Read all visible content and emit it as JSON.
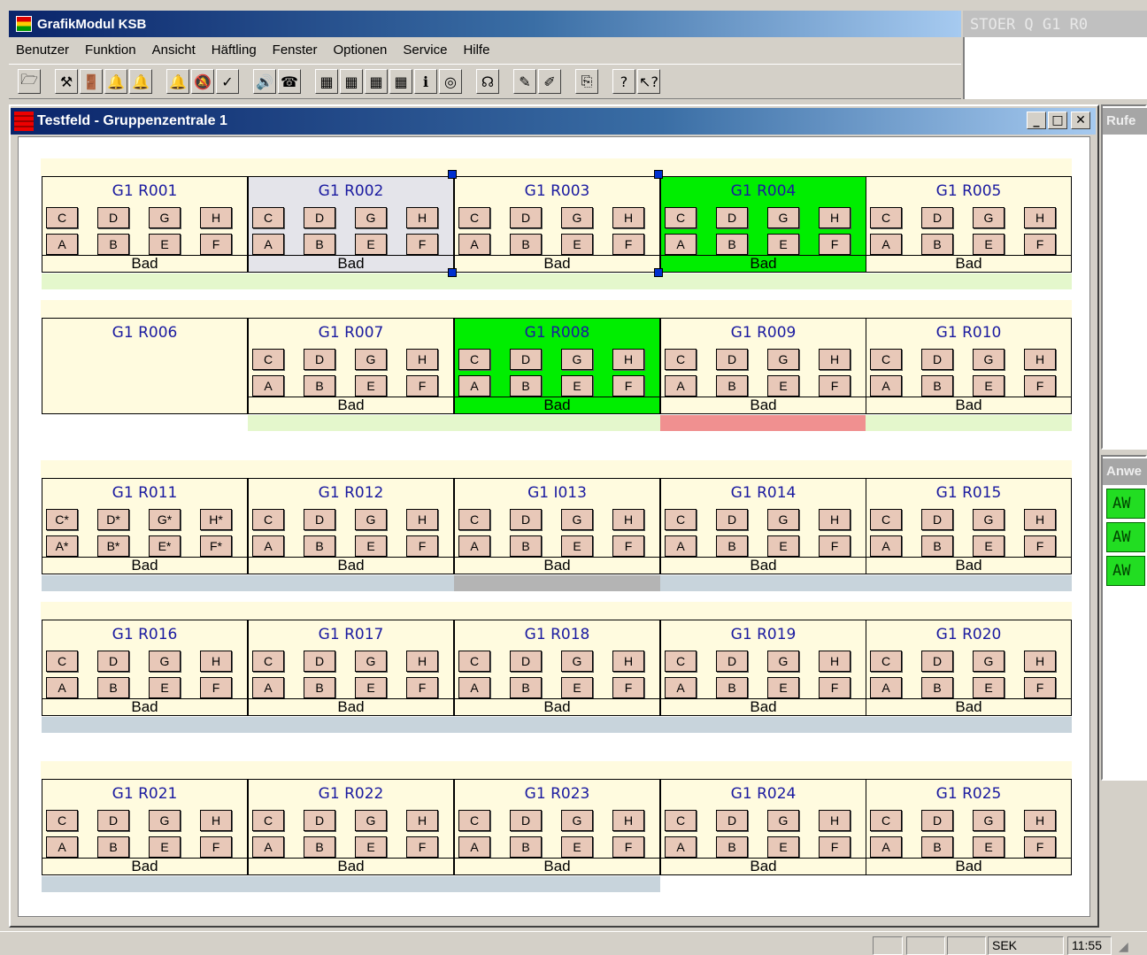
{
  "app": {
    "title": "GrafikModul KSB",
    "stoer_text": "STOER Q G1 R0",
    "menu": [
      "Benutzer",
      "Funktion",
      "Ansicht",
      "Häftling",
      "Fenster",
      "Optionen",
      "Service",
      "Hilfe"
    ],
    "toolbar_icons": [
      "open-icon",
      "hammer-icon",
      "door-icon",
      "bell-icon",
      "bell-green-icon",
      "bell-x-icon",
      "bell-gray-icon",
      "check-icon",
      "speaker-icon",
      "phone-icon",
      "calc-red-icon",
      "calc-red-icon",
      "calc-green-icon",
      "calc-gray-icon",
      "info-icon",
      "globe-icon",
      "ear-icon",
      "pen-icon",
      "pen2-icon",
      "copy-icon",
      "help-icon",
      "whatis-icon"
    ],
    "toolbar_glyphs": [
      "🗁",
      "⚒",
      "🚪",
      "🔔",
      "🔔",
      "🔔",
      "🔕",
      "✓",
      "🔊",
      "☎",
      "▦",
      "▦",
      "▦",
      "▦",
      "ℹ",
      "◎",
      "☊",
      "✎",
      "✐",
      "⎘",
      "?",
      "↖?"
    ]
  },
  "window": {
    "title": "Testfeld - Gruppenzentrale 1",
    "min": "_",
    "max": "□",
    "close": "✕"
  },
  "side": {
    "panel1_title": "Rufe",
    "panel2_title": "Anwe",
    "aw_items": [
      "AW",
      "AW",
      "AW"
    ]
  },
  "status": {
    "panes": [
      "",
      "",
      "",
      "SEK",
      "11:55"
    ]
  },
  "bed_labels": {
    "top": [
      "C",
      "D",
      "G",
      "H"
    ],
    "bottom": [
      "A",
      "B",
      "E",
      "F"
    ],
    "top_star": [
      "C*",
      "D*",
      "G*",
      "H*"
    ],
    "bottom_star": [
      "A*",
      "B*",
      "E*",
      "F*"
    ]
  },
  "bad_label": "Bad",
  "rooms": [
    {
      "name": "G1 R001",
      "state": "normal",
      "beds": true,
      "strip": "#e4f7cc"
    },
    {
      "name": "G1 R002",
      "state": "selected",
      "beds": true,
      "strip": "#e4f7cc"
    },
    {
      "name": "G1 R003",
      "state": "normal",
      "beds": true,
      "strip": "#e4f7cc"
    },
    {
      "name": "G1 R004",
      "state": "green",
      "beds": true,
      "strip": "#e4f7cc"
    },
    {
      "name": "G1 R005",
      "state": "normal",
      "beds": true,
      "strip": "#e4f7cc"
    },
    {
      "name": "G1 R006",
      "state": "normal",
      "beds": false,
      "strip": ""
    },
    {
      "name": "G1 R007",
      "state": "normal",
      "beds": true,
      "strip": "#e4f7cc"
    },
    {
      "name": "G1 R008",
      "state": "green",
      "beds": true,
      "strip": "#e4f7cc"
    },
    {
      "name": "G1 R009",
      "state": "normal",
      "beds": true,
      "strip": "#f09090"
    },
    {
      "name": "G1 R010",
      "state": "normal",
      "beds": true,
      "strip": "#e4f7cc"
    },
    {
      "name": "G1 R011",
      "state": "normal",
      "beds": true,
      "star": true,
      "strip": "#c8d4dc"
    },
    {
      "name": "G1 R012",
      "state": "normal",
      "beds": true,
      "strip": "#c8d4dc"
    },
    {
      "name": "G1 I013",
      "state": "normal",
      "beds": true,
      "strip": "#b4b4b4"
    },
    {
      "name": "G1 R014",
      "state": "normal",
      "beds": true,
      "strip": "#c8d4dc"
    },
    {
      "name": "G1 R015",
      "state": "normal",
      "beds": true,
      "strip": "#c8d4dc"
    },
    {
      "name": "G1 R016",
      "state": "normal",
      "beds": true,
      "strip": "#c8d4dc"
    },
    {
      "name": "G1 R017",
      "state": "normal",
      "beds": true,
      "strip": "#c8d4dc"
    },
    {
      "name": "G1 R018",
      "state": "normal",
      "beds": true,
      "strip": "#c8d4dc"
    },
    {
      "name": "G1 R019",
      "state": "normal",
      "beds": true,
      "strip": "#c8d4dc"
    },
    {
      "name": "G1 R020",
      "state": "normal",
      "beds": true,
      "strip": "#c8d4dc"
    },
    {
      "name": "G1 R021",
      "state": "normal",
      "beds": true,
      "strip": "#c8d4dc"
    },
    {
      "name": "G1 R022",
      "state": "normal",
      "beds": true,
      "strip": "#c8d4dc"
    },
    {
      "name": "G1 R023",
      "state": "normal",
      "beds": true,
      "strip": "#c8d4dc"
    },
    {
      "name": "G1 R024",
      "state": "normal",
      "beds": true,
      "strip": ""
    },
    {
      "name": "G1 R025",
      "state": "normal",
      "beds": true,
      "strip": ""
    }
  ]
}
